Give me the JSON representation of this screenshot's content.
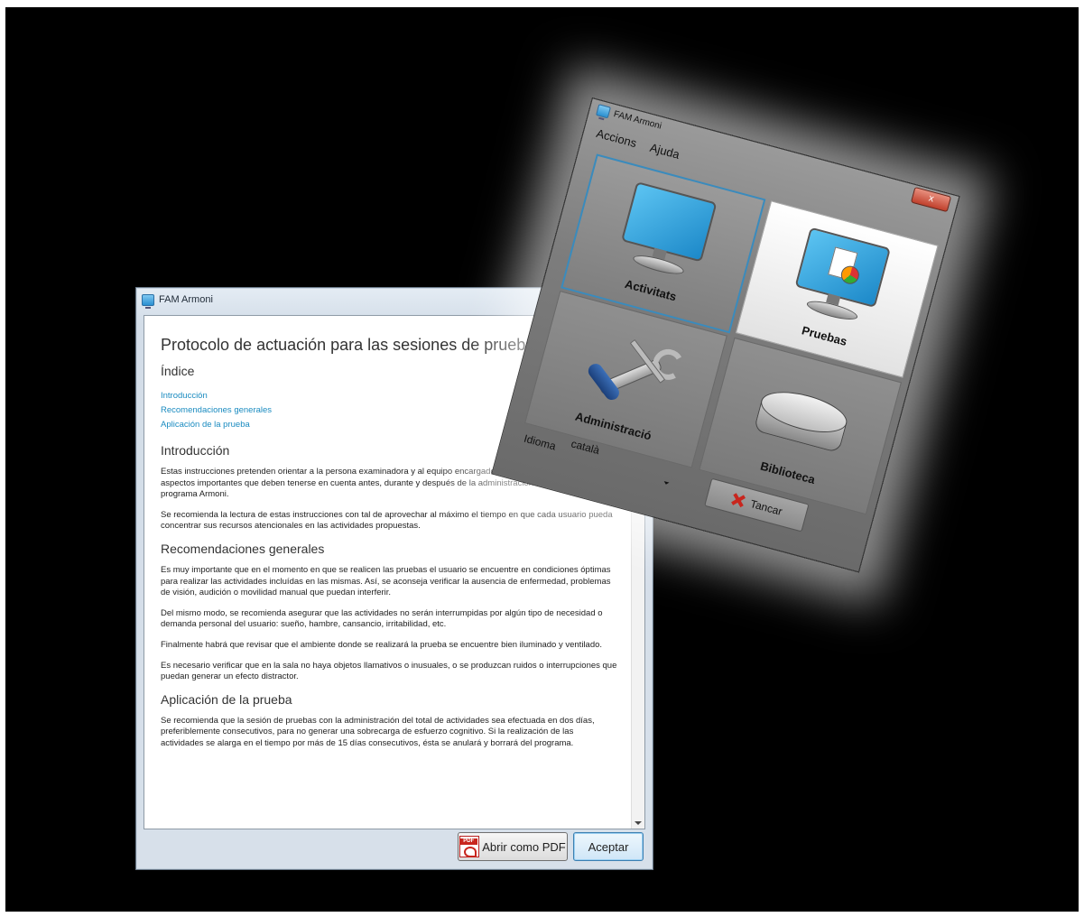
{
  "doc_window": {
    "title": "FAM Armoni",
    "main_title": "Protocolo de actuación para las sesiones de prueba",
    "index_title": "Índice",
    "toc": [
      "Introducción",
      "Recomendaciones generales",
      "Aplicación de la prueba"
    ],
    "sections": [
      {
        "title": "Introducción",
        "paragraphs": [
          "Estas instrucciones pretenden orientar a la persona examinadora y al equipo encargado de cada centro sobre los aspectos importantes que deben tenerse en cuenta antes, durante y después de la administración de la prueba con el programa Armoni.",
          "Se recomienda la lectura de estas instrucciones con tal de aprovechar al máximo el tiempo en que cada usuario pueda concentrar sus recursos atencionales en las actividades propuestas."
        ]
      },
      {
        "title": "Recomendaciones generales",
        "paragraphs": [
          "Es muy importante que en el momento en que se realicen las pruebas el usuario se encuentre en condiciones óptimas para realizar las actividades incluídas en las mismas. Así, se aconseja verificar la ausencia de enfermedad, problemas de visión, audición o movilidad manual que puedan interferir.",
          "Del mismo modo, se recomienda asegurar que las actividades no serán interrumpidas por algún tipo de necesidad o demanda personal del usuario: sueño, hambre, cansancio, irritabilidad, etc.",
          "Finalmente habrá que revisar que el ambiente donde se realizará la prueba se encuentre bien iluminado y ventilado.",
          "Es necesario verificar que en la sala no haya objetos llamativos o inusuales, o se produzcan ruidos o interrupciones que puedan generar un efecto distractor."
        ]
      },
      {
        "title": "Aplicación de la prueba",
        "paragraphs": [
          "Se recomienda que la sesión de pruebas con la administración del total de actividades sea efectuada en dos días, preferiblemente consecutivos, para no generar una sobrecarga de esfuerzo cognitivo. Si la realización de las actividades se alarga en el tiempo por más de 15 días consecutivos, ésta se anulará y borrará del programa."
        ]
      }
    ],
    "pdf_button": "Abrir como PDF",
    "pdf_icon_text": "PDF",
    "accept_button": "Aceptar"
  },
  "menu_window": {
    "title": "FAM Armoni",
    "close_glyph": "x",
    "menu": [
      "Accions",
      "Ajuda"
    ],
    "tiles": [
      "Activitats",
      "Pruebas",
      "Administració",
      "Biblioteca"
    ],
    "language_label": "Idioma",
    "language_value": "català",
    "close_button": "Tancar",
    "accent_color": "#3a8bbd"
  }
}
